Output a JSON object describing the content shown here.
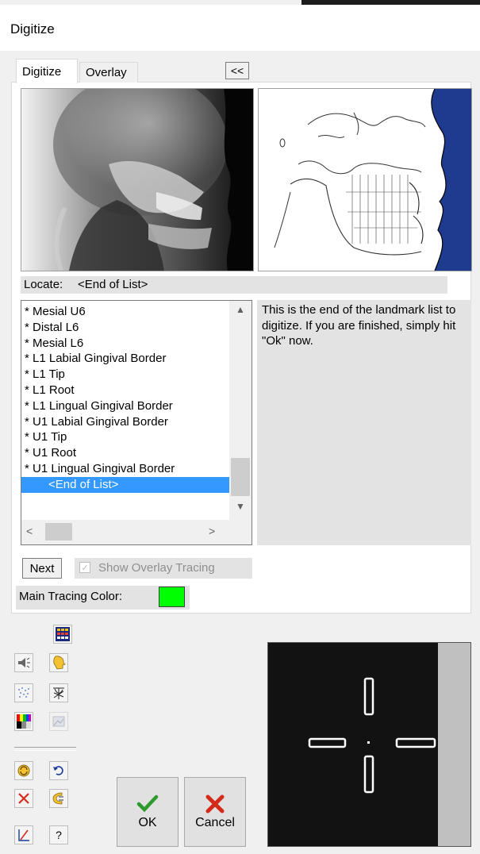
{
  "window": {
    "title": "Digitize"
  },
  "tabs": [
    {
      "label": "Digitize",
      "active": true
    },
    {
      "label": "Overlay",
      "active": false
    }
  ],
  "collapse_button": {
    "label": "<<"
  },
  "locate": {
    "label": "Locate:",
    "value": "<End of List>"
  },
  "landmarks": {
    "items": [
      "* Mesial U6",
      "* Distal L6",
      "* Mesial L6",
      "* L1 Labial Gingival Border",
      "* L1 Tip",
      "* L1 Root",
      "* L1 Lingual Gingival Border",
      "* U1 Labial Gingival Border",
      "* U1 Tip",
      "* U1 Root",
      "* U1 Lingual Gingival Border",
      "<End of List>"
    ],
    "selected_index": 11
  },
  "info": {
    "text": "This is the end of the landmark list to digitize.  If you are finished, simply hit \"Ok\" now."
  },
  "next_button": {
    "label": "Next"
  },
  "overlay_tracing": {
    "label": "Show Overlay Tracing",
    "checked": true,
    "enabled": false
  },
  "main_tracing_color": {
    "label": "Main Tracing Color:",
    "color": "#00ff00"
  },
  "buttons": {
    "ok_label": "OK",
    "cancel_label": "Cancel"
  },
  "colors": {
    "selection": "#3399ff",
    "profile_fill": "#1f3b8f",
    "ok_check": "#2e9a2e",
    "cancel_x": "#d42a1a"
  },
  "toolbar_icons": [
    "grid-icon",
    "sound-icon",
    "face-profile-icon",
    "dots-icon",
    "tracing-icon",
    "color-palette-icon",
    "image-adjust-icon",
    "refresh-icon",
    "undo-icon",
    "delete-icon",
    "caliper-icon",
    "measure-icon",
    "help-icon"
  ],
  "help_label": "?"
}
